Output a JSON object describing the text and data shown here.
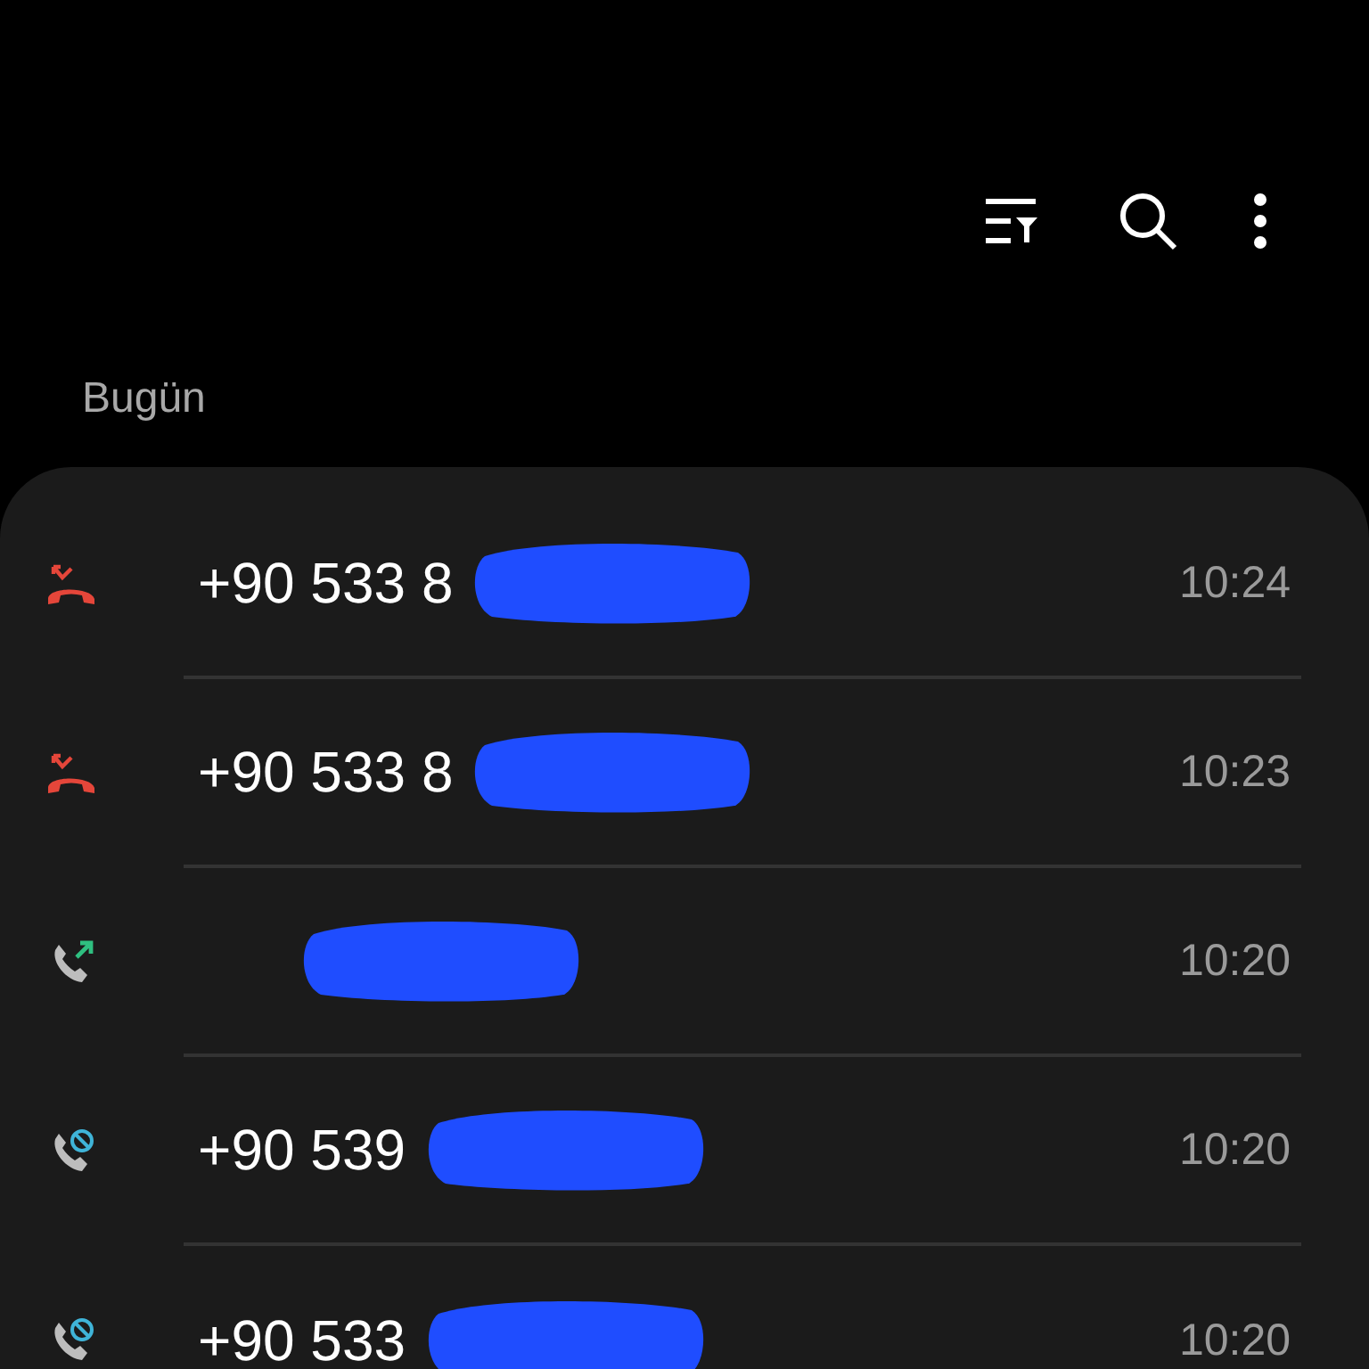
{
  "toolbar": {
    "actions": [
      {
        "kind": "filter"
      },
      {
        "kind": "search"
      },
      {
        "kind": "more"
      }
    ]
  },
  "section": {
    "title": "Bugün"
  },
  "calls": [
    {
      "kind": "missed",
      "number": "+90 533 8",
      "redacted": true,
      "time": "10:24"
    },
    {
      "kind": "missed",
      "number": "+90 533 8",
      "redacted": true,
      "time": "10:23"
    },
    {
      "kind": "outgoing",
      "redacted": true,
      "time": "10:20"
    },
    {
      "kind": "blocked",
      "number": "+90 539",
      "redacted": true,
      "time": "10:20"
    },
    {
      "kind": "blocked",
      "number": "+90 533",
      "redacted": true,
      "time": "10:20"
    }
  ]
}
